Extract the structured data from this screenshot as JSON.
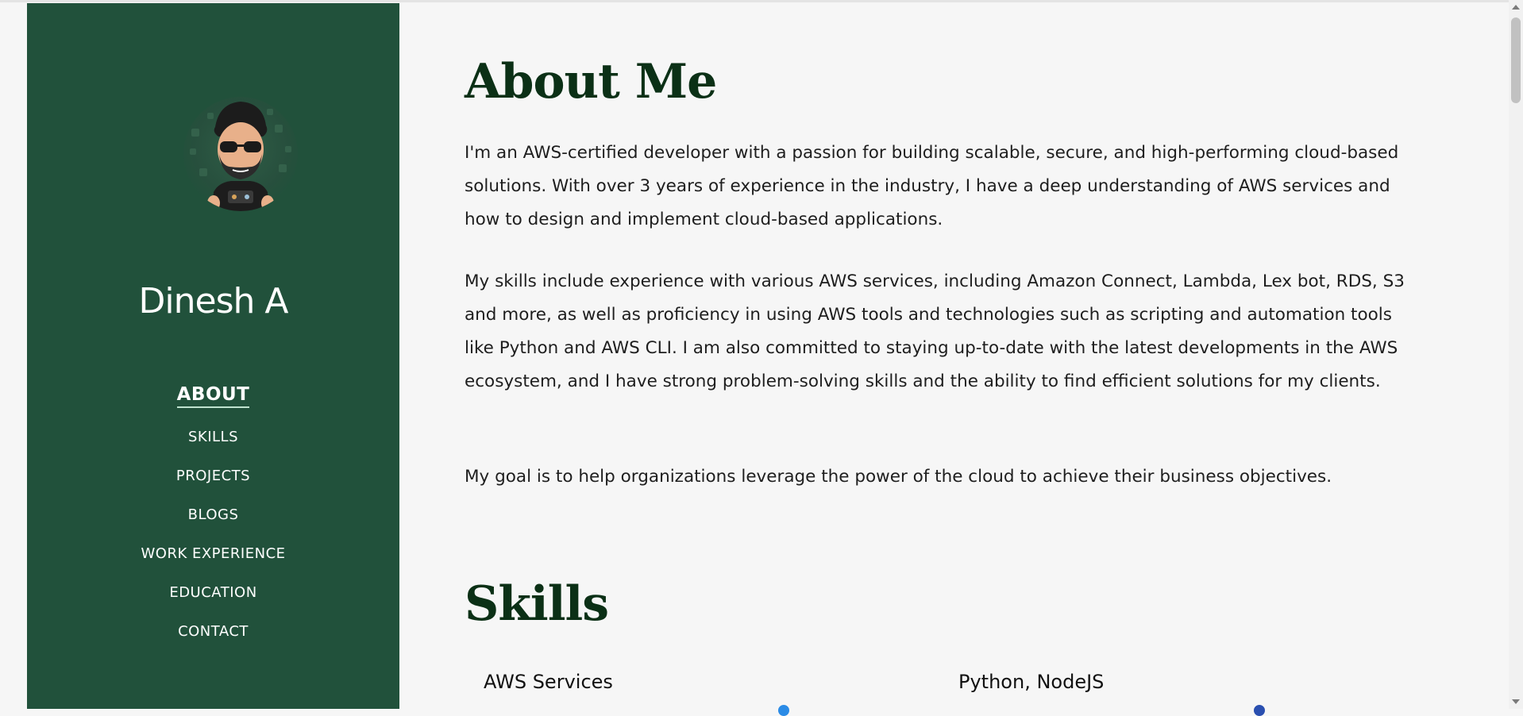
{
  "sidebar": {
    "name": "Dinesh A",
    "nav": [
      {
        "label": "ABOUT",
        "active": true
      },
      {
        "label": "SKILLS",
        "active": false
      },
      {
        "label": "PROJECTS",
        "active": false
      },
      {
        "label": "BLOGS",
        "active": false
      },
      {
        "label": "WORK EXPERIENCE",
        "active": false
      },
      {
        "label": "EDUCATION",
        "active": false
      },
      {
        "label": "CONTACT",
        "active": false
      }
    ],
    "avatar_icon": "profile-avatar"
  },
  "about": {
    "title": "About Me",
    "paragraphs": [
      "I'm an AWS-certified developer with a passion for building scalable, secure, and high-performing cloud-based solutions. With over 3 years of experience in the industry, I have a deep understanding of AWS services and how to design and implement cloud-based applications.",
      "My skills include experience with various AWS services, including Amazon Connect, Lambda, Lex bot, RDS, S3 and more, as well as proficiency in using AWS tools and technologies such as scripting and automation tools like Python and AWS CLI. I am also committed to staying up-to-date with the latest developments in the AWS ecosystem, and I have strong problem-solving skills and the ability to find efficient solutions for my clients.",
      "My goal is to help organizations leverage the power of the cloud to achieve their business objectives."
    ]
  },
  "skills": {
    "title": "Skills",
    "items": [
      {
        "label": "AWS Services"
      },
      {
        "label": "Python, NodeJS"
      }
    ]
  },
  "colors": {
    "sidebar_bg": "#21513b",
    "heading": "#0b3016",
    "page_bg": "#f6f6f6"
  }
}
